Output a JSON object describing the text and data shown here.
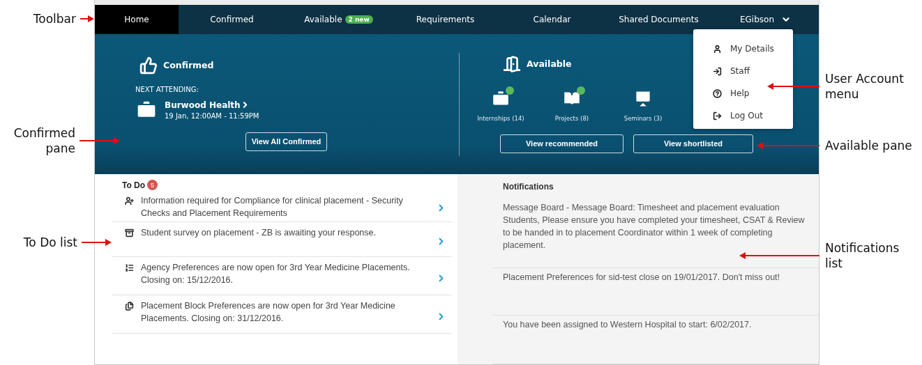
{
  "toolbar": {
    "tabs": [
      {
        "label": "Home",
        "selected": true
      },
      {
        "label": "Confirmed",
        "selected": false
      },
      {
        "label": "Available",
        "selected": false,
        "badge": "2 new"
      },
      {
        "label": "Requirements",
        "selected": false
      },
      {
        "label": "Calendar",
        "selected": false
      },
      {
        "label": "Shared Documents",
        "selected": false
      }
    ],
    "user": {
      "name": "EGibson",
      "expanded": true
    }
  },
  "user_menu": [
    {
      "label": "My Details"
    },
    {
      "label": "Staff"
    },
    {
      "label": "Help"
    },
    {
      "label": "Log Out"
    }
  ],
  "confirmed_pane": {
    "title": "Confirmed",
    "next_label": "NEXT ATTENDING:",
    "place": "Burwood Health",
    "time": "19 Jan, 12:00AM - 11:59PM",
    "button": "View All Confirmed"
  },
  "available_pane": {
    "title": "Available",
    "categories": [
      {
        "label": "Internships (14)",
        "new": true
      },
      {
        "label": "Projects (8)",
        "new": true
      },
      {
        "label": "Seminars (3)",
        "new": false
      }
    ],
    "buttons": [
      "View recommended",
      "View shortlisted"
    ]
  },
  "todo": {
    "title": "To Do",
    "count": "5",
    "items": [
      {
        "text": "Information required for Compliance for clinical placement - Security Checks and Placement Requirements"
      },
      {
        "text": "Student survey on placement - ZB is awaiting your response."
      },
      {
        "text": "Agency Preferences are now open for 3rd Year Medicine Placements. Closing on: 15/12/2016."
      },
      {
        "text": "Placement Block Preferences are now open for 3rd Year Medicine Placements. Closing on: 31/12/2016."
      }
    ]
  },
  "notifications": {
    "title": "Notifications",
    "items": [
      "Message Board - Message Board: Timesheet and placement evaluation Students,  Please ensure you have completed your timesheet, CSAT & Review to be handed in to placement Coordinator within 1 week of completing placement.",
      "Placement Preferences for sid-test close on 19/01/2017. Don't miss out!",
      "You have been assigned to Western Hospital to start: 6/02/2017."
    ]
  },
  "annotations": {
    "left": [
      "Toolbar",
      "Confirmed pane",
      "To Do list"
    ],
    "right": [
      "User Account menu",
      "Available pane",
      "Notifications list"
    ]
  }
}
